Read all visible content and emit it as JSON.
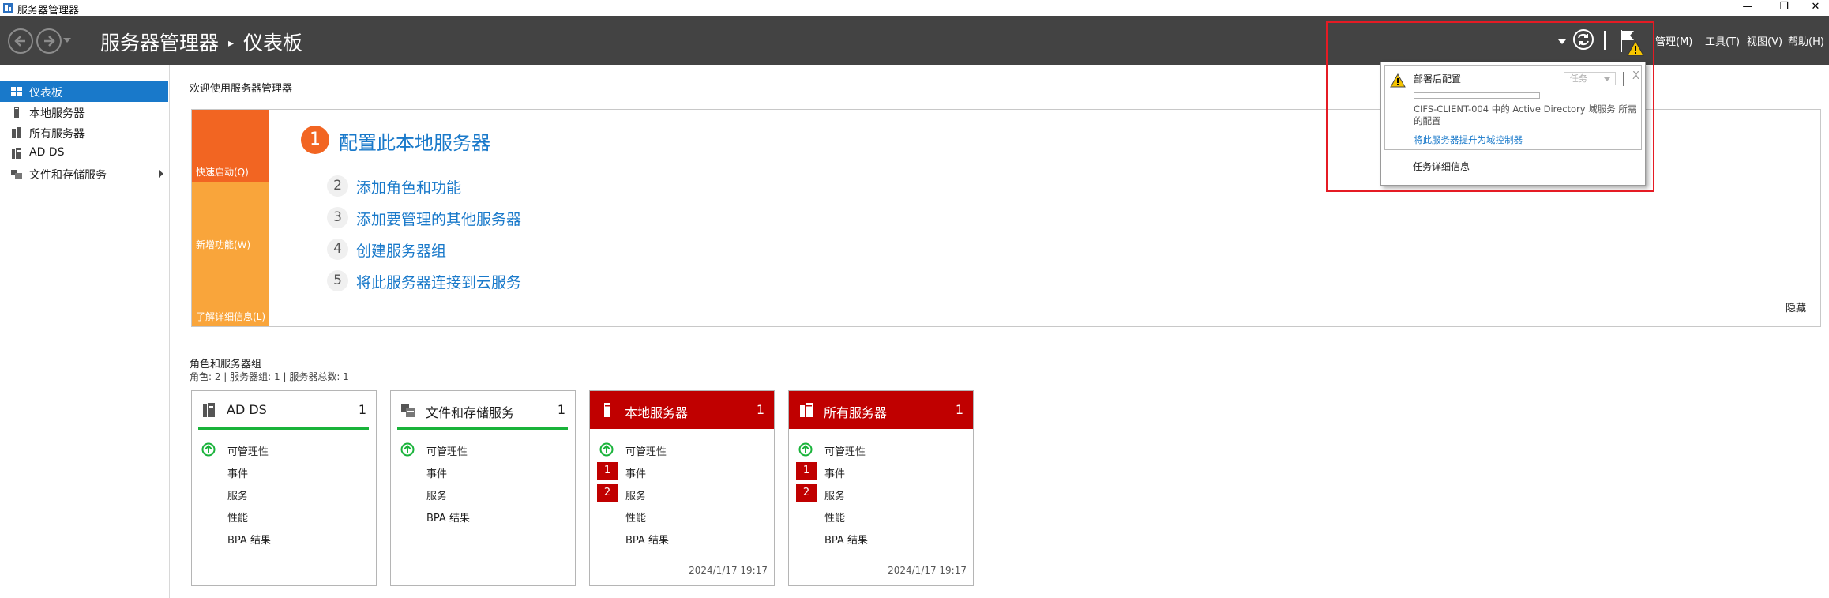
{
  "window": {
    "title": "服务器管理器",
    "controls": {
      "minimize": "—",
      "restore": "❐",
      "close": "✕"
    }
  },
  "header": {
    "breadcrumb_app": "服务器管理器",
    "breadcrumb_separator": "▸",
    "breadcrumb_page": "仪表板",
    "menus": [
      {
        "label": "管理(M)"
      },
      {
        "label": "工具(T)"
      },
      {
        "label": "视图(V)"
      },
      {
        "label": "帮助(H)"
      }
    ]
  },
  "sidebar": {
    "items": [
      {
        "label": "仪表板",
        "icon": "dashboard-icon",
        "active": true
      },
      {
        "label": "本地服务器",
        "icon": "server-icon"
      },
      {
        "label": "所有服务器",
        "icon": "servers-icon"
      },
      {
        "label": "AD DS",
        "icon": "ad-ds-icon"
      },
      {
        "label": "文件和存储服务",
        "icon": "file-storage-icon",
        "has_submenu": true
      }
    ]
  },
  "welcome": {
    "title": "欢迎使用服务器管理器",
    "tiles": [
      {
        "label": "快速启动(Q)",
        "color": "#f26522"
      },
      {
        "label": "新增功能(W)",
        "color": "#f9a53b"
      },
      {
        "label": "了解详细信息(L)",
        "color": "#f9a53b"
      }
    ],
    "main_step": {
      "number": "1",
      "label": "配置此本地服务器"
    },
    "steps": [
      {
        "number": "2",
        "label": "添加角色和功能"
      },
      {
        "number": "3",
        "label": "添加要管理的其他服务器"
      },
      {
        "number": "4",
        "label": "创建服务器组"
      },
      {
        "number": "5",
        "label": "将此服务器连接到云服务"
      }
    ],
    "hide": "隐藏"
  },
  "roles": {
    "title": "角色和服务器组",
    "summary": "角色: 2 | 服务器组: 1 | 服务器总数: 1",
    "tiles": [
      {
        "name": "AD DS",
        "count": "1",
        "status": "ok",
        "icon": "ad-ds-icon",
        "rows": [
          {
            "label": "可管理性",
            "badge": ""
          },
          {
            "label": "事件",
            "badge": ""
          },
          {
            "label": "服务",
            "badge": ""
          },
          {
            "label": "性能",
            "badge": ""
          },
          {
            "label": "BPA 结果",
            "badge": ""
          }
        ],
        "timestamp": ""
      },
      {
        "name": "文件和存储服务",
        "count": "1",
        "status": "ok",
        "icon": "file-storage-icon",
        "rows": [
          {
            "label": "可管理性",
            "badge": ""
          },
          {
            "label": "事件",
            "badge": ""
          },
          {
            "label": "服务",
            "badge": ""
          },
          {
            "label": "BPA 结果",
            "badge": ""
          }
        ],
        "timestamp": ""
      },
      {
        "name": "本地服务器",
        "count": "1",
        "status": "alert",
        "icon": "server-icon",
        "rows": [
          {
            "label": "可管理性",
            "badge": ""
          },
          {
            "label": "事件",
            "badge": "1"
          },
          {
            "label": "服务",
            "badge": "2"
          },
          {
            "label": "性能",
            "badge": ""
          },
          {
            "label": "BPA 结果",
            "badge": ""
          }
        ],
        "timestamp": "2024/1/17 19:17"
      },
      {
        "name": "所有服务器",
        "count": "1",
        "status": "alert",
        "icon": "servers-icon",
        "rows": [
          {
            "label": "可管理性",
            "badge": ""
          },
          {
            "label": "事件",
            "badge": "1"
          },
          {
            "label": "服务",
            "badge": "2"
          },
          {
            "label": "性能",
            "badge": ""
          },
          {
            "label": "BPA 结果",
            "badge": ""
          }
        ],
        "timestamp": "2024/1/17 19:17"
      }
    ]
  },
  "notification": {
    "title": "部署后配置",
    "tasks_label": "任务",
    "close": "X",
    "progress": 0,
    "message": "CIFS-CLIENT-004 中的 Active Directory 域服务 所需的配置",
    "link": "将此服务器提升为域控制器",
    "details": "任务详细信息"
  },
  "colors": {
    "header_bg": "#434343",
    "accent_blue": "#1979ca",
    "quick_start_orange": "#f26522",
    "tile_orange": "#f9a53b",
    "alert_red": "#c00000",
    "ok_green": "#19b33a",
    "highlight_red": "#e51b24"
  }
}
